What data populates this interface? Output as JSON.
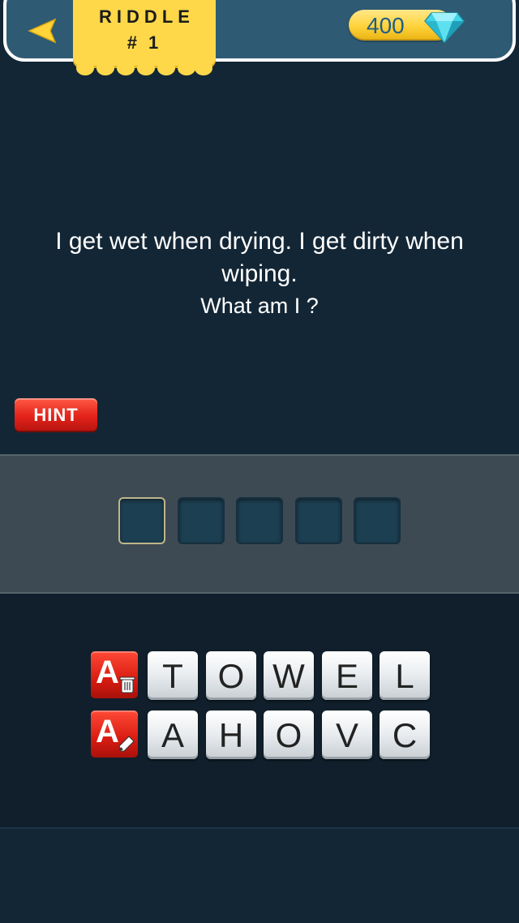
{
  "header": {
    "riddle_label": "RIDDLE",
    "riddle_number": "# 1",
    "coins": "400"
  },
  "question": {
    "text": "I get wet when drying. I get dirty when wiping.",
    "prompt": "What am I ?"
  },
  "hint_label": "HINT",
  "answer": {
    "slots": 5,
    "active_slot": 1
  },
  "letters": {
    "row1": [
      "T",
      "O",
      "W",
      "E",
      "L"
    ],
    "row2": [
      "A",
      "H",
      "O",
      "V",
      "C"
    ]
  },
  "tools": {
    "remove_letters_icon": "letter-a-trash-icon",
    "reveal_letter_icon": "letter-a-pencil-icon"
  },
  "colors": {
    "background": "#132635",
    "header": "#2f5a73",
    "tab_yellow": "#ffd84a",
    "hint_red": "#e4231b",
    "coin_text": "#1f5e86",
    "gem": "#3fd6e8"
  }
}
